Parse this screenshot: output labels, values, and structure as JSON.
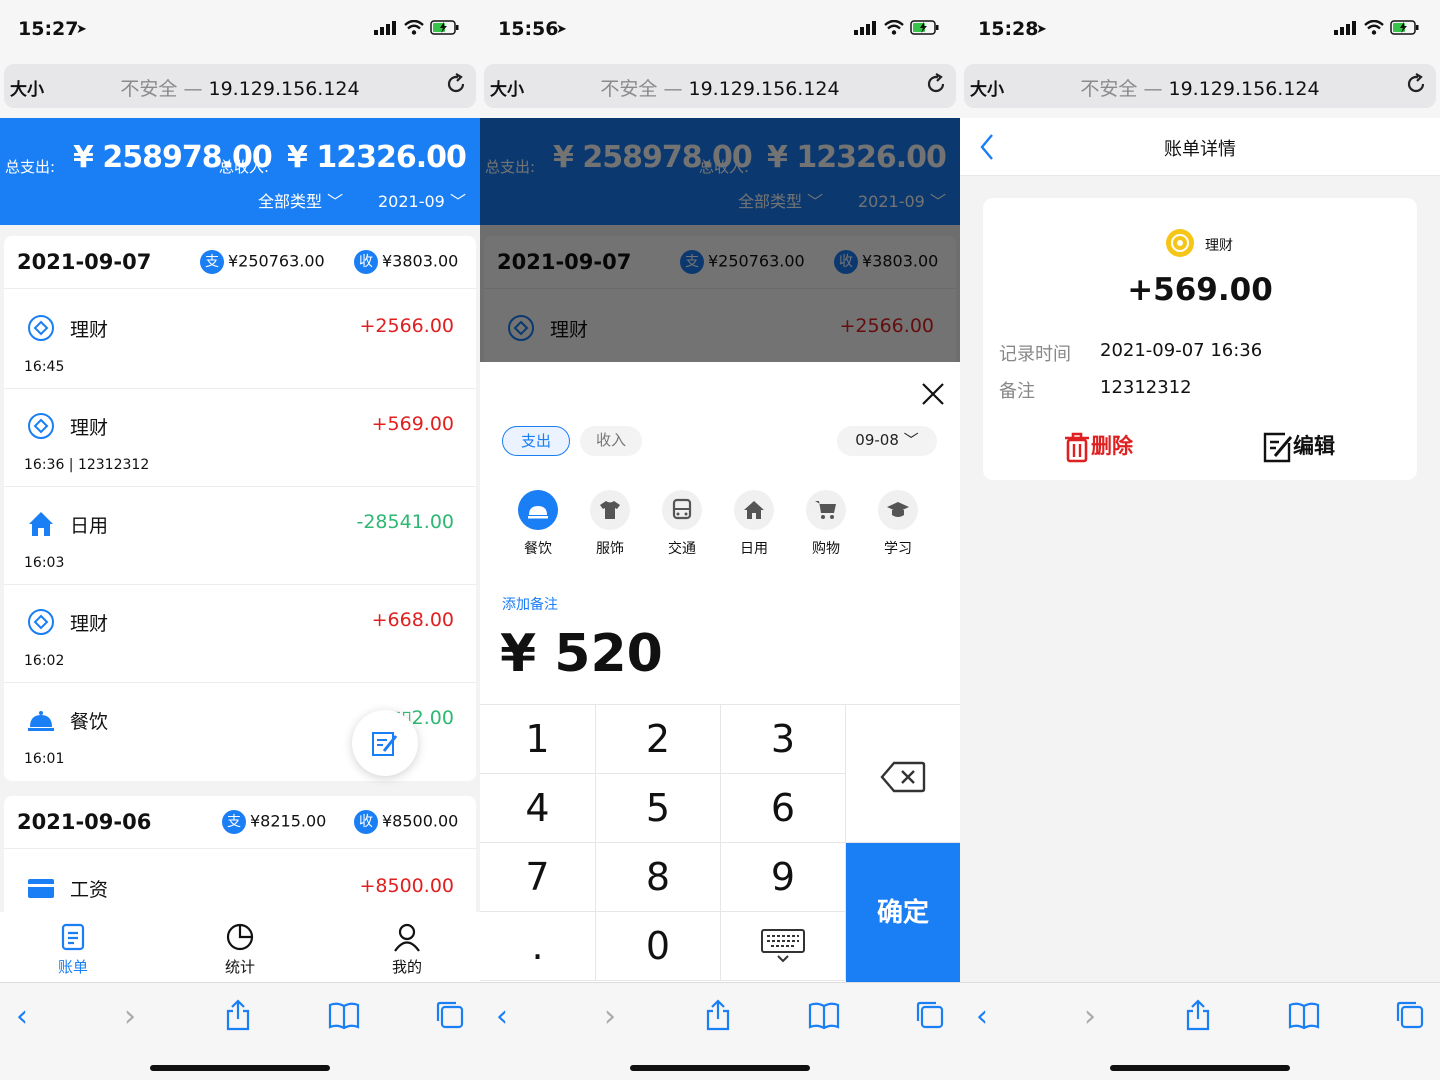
{
  "status_bars": [
    {
      "time": "15:27"
    },
    {
      "time": "15:56"
    },
    {
      "time": "15:28"
    }
  ],
  "browser": {
    "text_size": "大小",
    "not_secure": "不安全 —",
    "host": "19.129.156.124"
  },
  "ledger": {
    "total_expense_label": "总支出:",
    "total_expense": "¥ 258978.00",
    "total_income_label": "总收入:",
    "total_income": "¥ 12326.00",
    "type_filter": "全部类型",
    "month_filter": "2021-09",
    "expense_tag": "支",
    "income_tag": "收",
    "days": [
      {
        "date": "2021-09-07",
        "expense": "¥250763.00",
        "income": "¥3803.00",
        "items": [
          {
            "category": "理财",
            "amount": "+2566.00",
            "meta": "16:45"
          },
          {
            "category": "理财",
            "amount": "+569.00",
            "meta": "16:36 | 12312312"
          },
          {
            "category": "日用",
            "amount": "-28541.00",
            "meta": "16:03"
          },
          {
            "category": "理财",
            "amount": "+668.00",
            "meta": "16:02"
          },
          {
            "category": "餐饮",
            "amount": "-2▯▯2.00",
            "amount_left": "-2",
            "amount_right": "2.00",
            "meta": "16:01"
          }
        ]
      },
      {
        "date": "2021-09-06",
        "expense": "¥8215.00",
        "income": "¥8500.00",
        "items": [
          {
            "category": "工资",
            "amount": "+8500.00"
          }
        ]
      }
    ],
    "tabs": [
      "账单",
      "统计",
      "我的"
    ]
  },
  "add_entry": {
    "type_expense": "支出",
    "type_income": "收入",
    "date": "09-08",
    "categories": [
      "餐饮",
      "服饰",
      "交通",
      "日用",
      "购物",
      "学习"
    ],
    "add_note": "添加备注",
    "amount": "¥ 520",
    "keys": [
      "1",
      "2",
      "3",
      "4",
      "5",
      "6",
      "7",
      "8",
      "9",
      ".",
      "0"
    ],
    "confirm": "确定"
  },
  "detail": {
    "title": "账单详情",
    "category": "理财",
    "amount": "+569.00",
    "time_label": "记录时间",
    "time_value": "2021-09-07 16:36",
    "note_label": "备注",
    "note_value": "12312312",
    "delete": "删除",
    "edit": "编辑"
  },
  "colors": {
    "accent": "#1a7ef5",
    "income": "#e02020",
    "expense": "#2eb873",
    "coin": "#f5c518"
  }
}
